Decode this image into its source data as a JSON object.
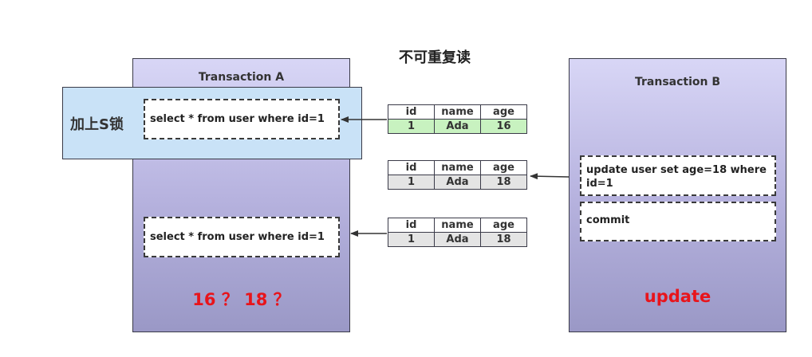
{
  "title": "不可重复读",
  "transaction_a": {
    "label": "Transaction A",
    "lock_label": "加上S锁",
    "statement_1": "select * from user where id=1",
    "statement_2": "select * from user where id=1",
    "note": "16 ？ 18 ？"
  },
  "transaction_b": {
    "label": "Transaction B",
    "update_statement": "update user set age=18 where id=1",
    "commit_statement": "commit",
    "note": "update"
  },
  "tables": [
    {
      "headers": [
        "id",
        "name",
        "age"
      ],
      "row": [
        "1",
        "Ada",
        "16"
      ],
      "row_color": "#c8f2c0"
    },
    {
      "headers": [
        "id",
        "name",
        "age"
      ],
      "row": [
        "1",
        "Ada",
        "18"
      ],
      "row_color": "#e4e4e4"
    },
    {
      "headers": [
        "id",
        "name",
        "age"
      ],
      "row": [
        "1",
        "Ada",
        "18"
      ],
      "row_color": "#e4e4e4"
    }
  ],
  "colors": {
    "panel_top": "#d8d6f6",
    "panel_bottom": "#9a98c6",
    "lock_box": "#c9e2f7",
    "note_red": "#e8141b"
  }
}
